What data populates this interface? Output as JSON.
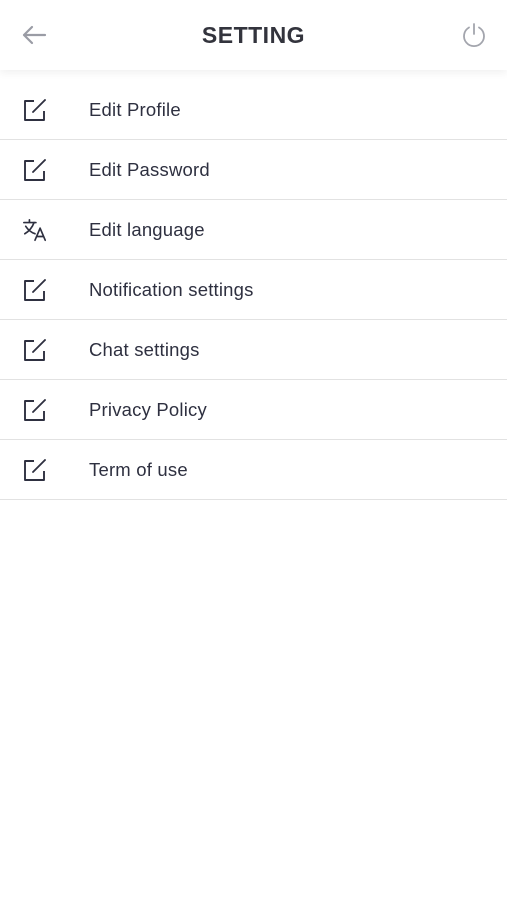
{
  "header": {
    "title": "SETTING",
    "back_icon": "arrow-left-icon",
    "power_icon": "power-icon"
  },
  "menu": {
    "items": [
      {
        "label": "Edit Profile",
        "icon": "edit-icon"
      },
      {
        "label": "Edit Password",
        "icon": "edit-icon"
      },
      {
        "label": "Edit language",
        "icon": "translate-icon"
      },
      {
        "label": "Notification settings",
        "icon": "edit-icon"
      },
      {
        "label": "Chat settings",
        "icon": "edit-icon"
      },
      {
        "label": "Privacy Policy",
        "icon": "edit-icon"
      },
      {
        "label": "Term of use",
        "icon": "edit-icon"
      }
    ]
  },
  "colors": {
    "text": "#2e3040",
    "icon_muted": "#9a9ca5",
    "divider": "#e2e2e2",
    "background": "#ffffff"
  }
}
